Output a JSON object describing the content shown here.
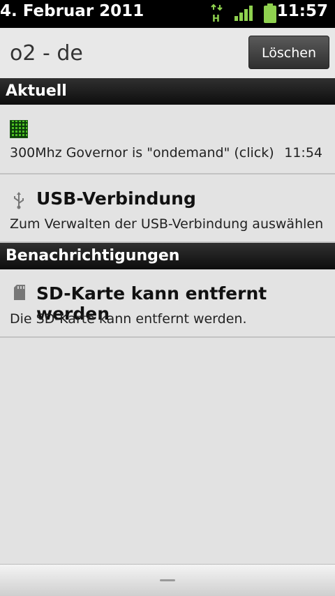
{
  "status_bar": {
    "date": "4. Februar 2011",
    "time": "11:57",
    "network_type": "H",
    "icons": [
      "data-transfer-icon",
      "signal-strength-icon",
      "battery-icon"
    ],
    "accent_color": "#8fd14f"
  },
  "header": {
    "carrier": "o2 - de",
    "clear_label": "Löschen"
  },
  "sections": {
    "ongoing_title": "Aktuell",
    "notifications_title": "Benachrichtigungen"
  },
  "notifications": {
    "governor": {
      "icon": "cpu-icon",
      "text": "300Mhz Governor is \"ondemand\" (click)",
      "time": "11:54"
    },
    "usb": {
      "icon": "usb-icon",
      "title": "USB-Verbindung",
      "text": "Zum Verwalten der USB-Verbindung auswählen"
    },
    "sd": {
      "icon": "sd-card-icon",
      "title": "SD-Karte kann entfernt werden",
      "text": "Die SD-Karte kann entfernt werden."
    }
  }
}
